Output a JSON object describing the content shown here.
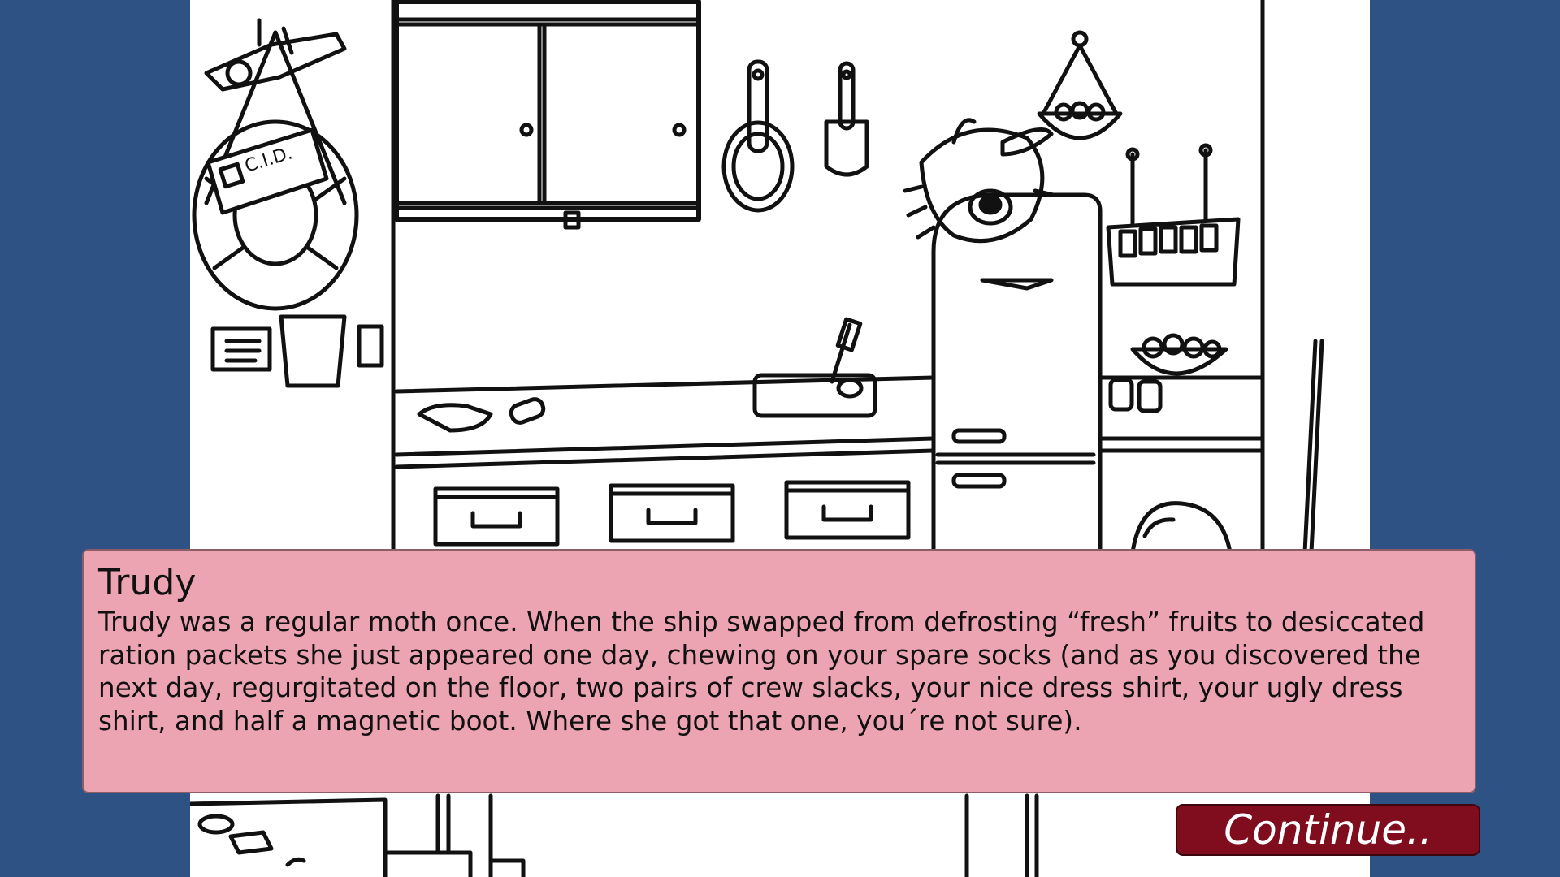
{
  "dialog": {
    "speaker": "Trudy",
    "text": "Trudy was a regular moth once. When the ship swapped from defrosting “fresh” fruits to desiccated ration packets she just appeared one day, chewing on your spare socks (and as you discovered the next day, regurgitated on the floor, two pairs of crew slacks, your nice dress shirt, your ugly dress shirt, and half a magnetic boot. Where she got that one, you´re not sure)."
  },
  "controls": {
    "continue_label": "Continue.."
  },
  "scene": {
    "id_card_text": "C.I.D.",
    "background_color": "#2f5285",
    "dialog_color": "#eca3b2",
    "button_color": "#7f0d1e"
  }
}
